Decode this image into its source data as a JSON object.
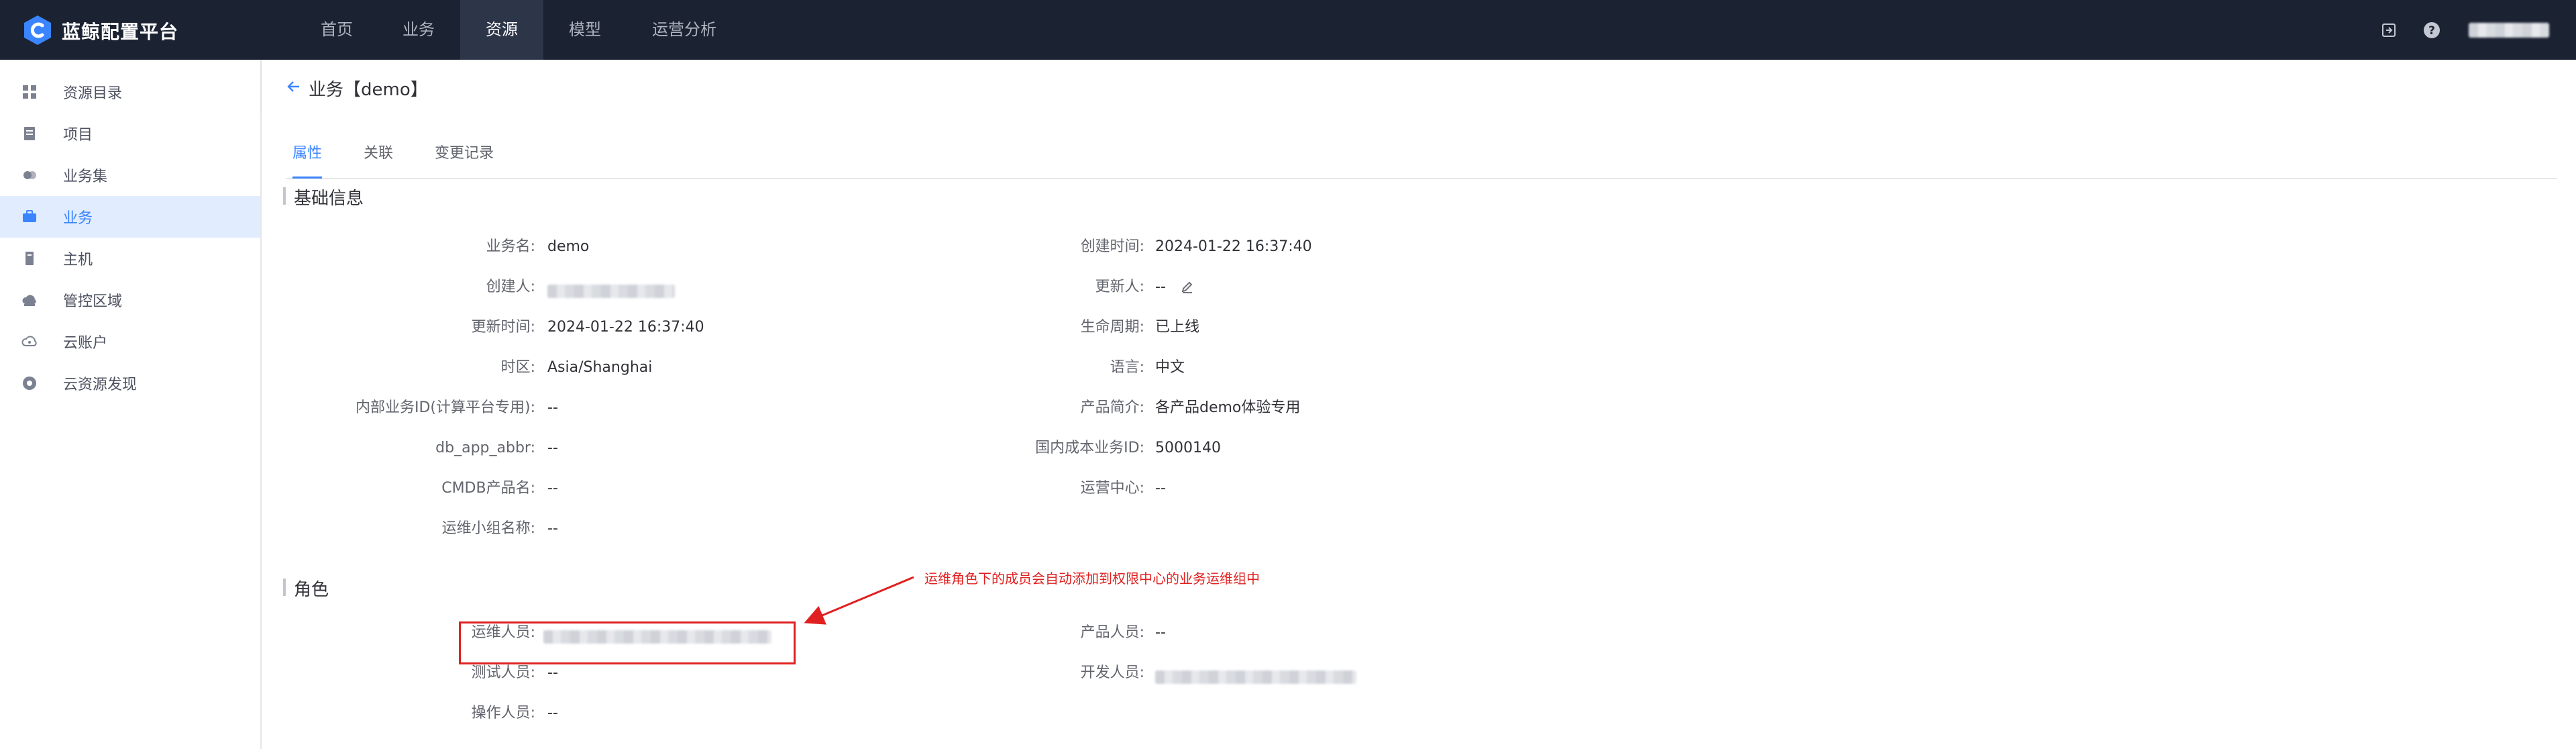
{
  "app": {
    "brand": "蓝鲸配置平台"
  },
  "topnav": [
    {
      "label": "首页",
      "active": false
    },
    {
      "label": "业务",
      "active": false
    },
    {
      "label": "资源",
      "active": true
    },
    {
      "label": "模型",
      "active": false
    },
    {
      "label": "运营分析",
      "active": false
    }
  ],
  "topbar_icons": [
    "export-icon",
    "help-icon"
  ],
  "sidebar": {
    "items": [
      {
        "label": "资源目录",
        "icon": "grid-icon",
        "active": false
      },
      {
        "label": "项目",
        "icon": "project-icon",
        "active": false
      },
      {
        "label": "业务集",
        "icon": "business-set-icon",
        "active": false
      },
      {
        "label": "业务",
        "icon": "business-icon",
        "active": true
      },
      {
        "label": "主机",
        "icon": "host-icon",
        "active": false
      },
      {
        "label": "管控区域",
        "icon": "cloud-area-icon",
        "active": false
      },
      {
        "label": "云账户",
        "icon": "cloud-account-icon",
        "active": false
      },
      {
        "label": "云资源发现",
        "icon": "cloud-discovery-icon",
        "active": false
      }
    ]
  },
  "header": {
    "title": "业务【demo】"
  },
  "tabs": [
    {
      "label": "属性",
      "active": true
    },
    {
      "label": "关联",
      "active": false
    },
    {
      "label": "变更记录",
      "active": false
    }
  ],
  "basic_info": {
    "title": "基础信息",
    "left": [
      {
        "label": "业务名:",
        "value": "demo"
      },
      {
        "label": "创建人:",
        "value": ""
      },
      {
        "label": "更新时间:",
        "value": "2024-01-22 16:37:40"
      },
      {
        "label": "时区:",
        "value": "Asia/Shanghai"
      },
      {
        "label": "内部业务ID(计算平台专用):",
        "value": "--"
      },
      {
        "label": "db_app_abbr:",
        "value": "--"
      },
      {
        "label": "CMDB产品名:",
        "value": "--"
      },
      {
        "label": "运维小组名称:",
        "value": "--"
      }
    ],
    "right": [
      {
        "label": "创建时间:",
        "value": "2024-01-22 16:37:40"
      },
      {
        "label": "更新人:",
        "value": "--"
      },
      {
        "label": "生命周期:",
        "value": "已上线"
      },
      {
        "label": "语言:",
        "value": "中文"
      },
      {
        "label": "产品简介:",
        "value": "各产品demo体验专用"
      },
      {
        "label": "国内成本业务ID:",
        "value": "5000140"
      },
      {
        "label": "运营中心:",
        "value": "--"
      }
    ]
  },
  "roles": {
    "title": "角色",
    "left": [
      {
        "label": "运维人员:",
        "value": ""
      },
      {
        "label": "测试人员:",
        "value": "--"
      },
      {
        "label": "操作人员:",
        "value": "--"
      }
    ],
    "right": [
      {
        "label": "产品人员:",
        "value": "--"
      },
      {
        "label": "开发人员:",
        "value": ""
      }
    ]
  },
  "annotation": {
    "text": "运维角色下的成员会自动添加到权限中心的业务运维组中",
    "color": "#e02020"
  },
  "colors": {
    "topbar": "#1b2232",
    "accent": "#3a84ff",
    "sidebar_active_bg": "#e1ecff"
  }
}
